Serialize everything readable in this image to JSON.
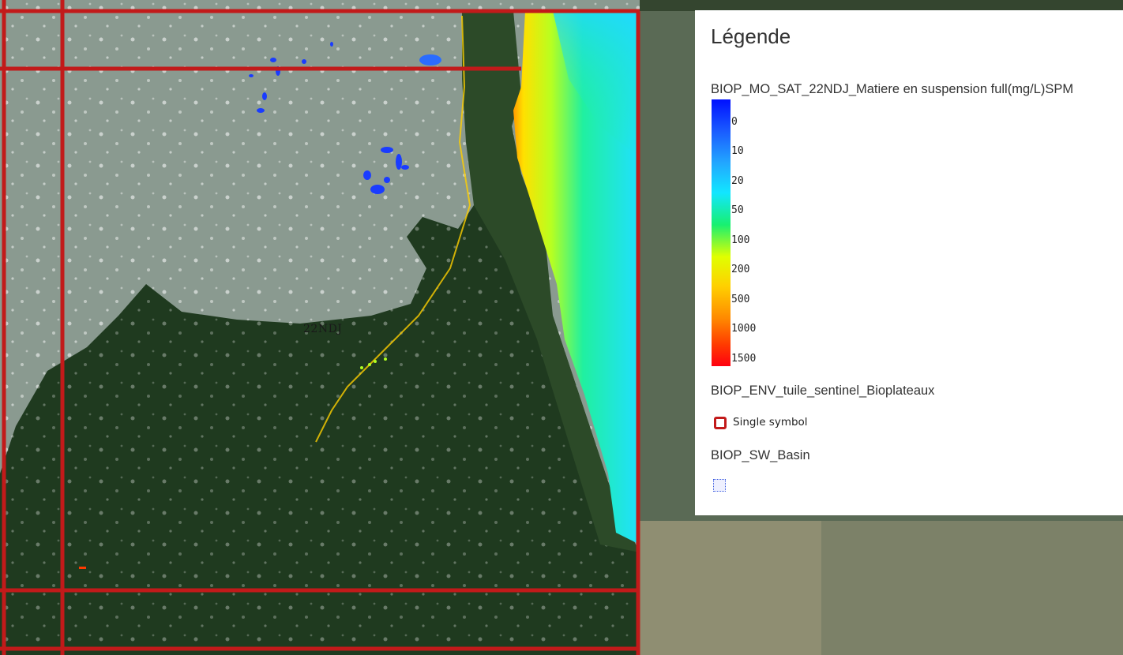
{
  "map": {
    "tile_label": "22NDJ"
  },
  "legend": {
    "title": "Légende",
    "layers": [
      {
        "name": "BIOP_MO_SAT_22NDJ_Matiere en suspension full(mg/L)SPM"
      },
      {
        "name": "BIOP_ENV_tuile_sentinel_Bioplateaux"
      },
      {
        "name": "BIOP_SW_Basin"
      }
    ],
    "ramp_labels": [
      "0",
      "10",
      "20",
      "50",
      "100",
      "200",
      "500",
      "1000",
      "1500"
    ],
    "single_symbol_label": "Single symbol",
    "colors": {
      "grid_red": "#c21a1a",
      "spm_low": "#0010ff",
      "spm_high": "#ff0010",
      "basin_blue": "#3a5adf"
    }
  }
}
